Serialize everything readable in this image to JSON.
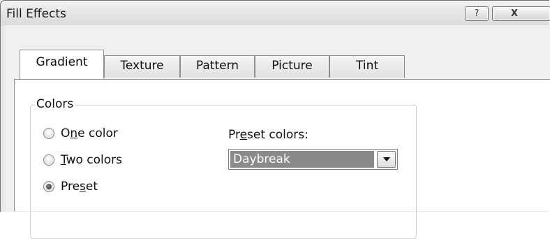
{
  "window": {
    "title": "Fill Effects",
    "help_glyph": "?",
    "close_glyph": "X"
  },
  "tabs": [
    {
      "label": "Gradient",
      "active": true
    },
    {
      "label": "Texture",
      "active": false
    },
    {
      "label": "Pattern",
      "active": false
    },
    {
      "label": "Picture",
      "active": false
    },
    {
      "label": "Tint",
      "active": false
    }
  ],
  "colors_group": {
    "label": "Colors",
    "options": [
      {
        "pre": "O",
        "accel": "n",
        "post": "e color",
        "checked": false
      },
      {
        "pre": "",
        "accel": "T",
        "post": "wo colors",
        "checked": false
      },
      {
        "pre": "Pre",
        "accel": "s",
        "post": "et",
        "checked": true
      }
    ]
  },
  "preset": {
    "label_pre": "Pr",
    "label_accel": "e",
    "label_post": "set colors:",
    "selected": "Daybreak"
  }
}
